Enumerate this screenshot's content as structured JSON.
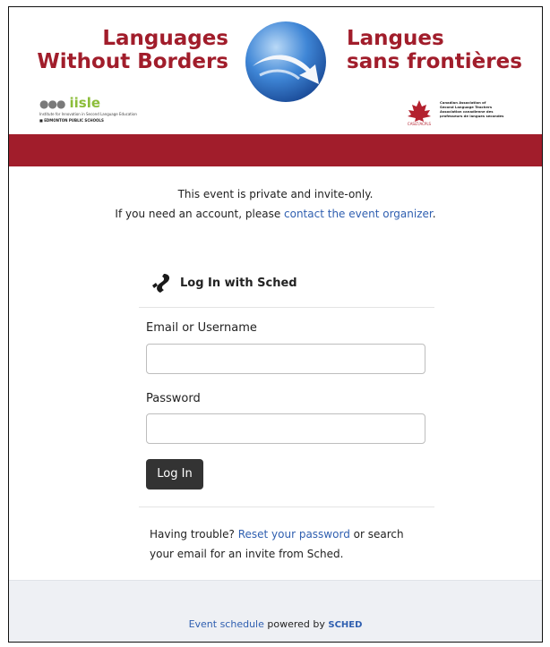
{
  "banner": {
    "title_en_line1": "Languages",
    "title_en_line2": "Without Borders",
    "title_fr_line1": "Langues",
    "title_fr_line2": "sans frontières",
    "iisle_word": "iisle",
    "iisle_line1": "Institute for Innovation in Second Language Education",
    "iisle_line2": "EDMONTON PUBLIC SCHOOLS",
    "caslt_line1": "Canadian Association of",
    "caslt_line2": "Second Language Teachers",
    "caslt_line3": "Association canadienne des",
    "caslt_line4": "professeurs de langues secondes",
    "caslt_acronym": "CASLT/ACPLS",
    "accent_color": "#a11d2b"
  },
  "notice": {
    "line1": "This event is private and invite-only.",
    "line2_prefix": "If you need an account, please ",
    "line2_link": "contact the event organizer",
    "line2_suffix": "."
  },
  "login": {
    "title": "Log In with Sched",
    "email_label": "Email or Username",
    "email_value": "",
    "password_label": "Password",
    "password_value": "",
    "submit_label": "Log In",
    "trouble_prefix": "Having trouble? ",
    "trouble_link": "Reset your password",
    "trouble_suffix": " or search your email for an invite from Sched."
  },
  "footer": {
    "link_text": "Event schedule",
    "middle_text": " powered by ",
    "brand": "SCHED"
  }
}
